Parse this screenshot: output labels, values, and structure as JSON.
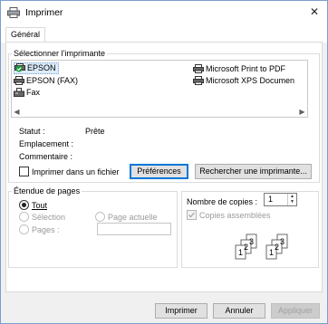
{
  "window": {
    "title": "Imprimer",
    "close_glyph": "✕"
  },
  "tabs": [
    {
      "label": "Général"
    }
  ],
  "printer_group": {
    "label": "Sélectionner l’imprimante",
    "printers": [
      {
        "name": "EPSON",
        "icon": "printer-default-icon",
        "selected": true
      },
      {
        "name": "Microsoft Print to PDF",
        "icon": "printer-icon"
      },
      {
        "name": "EPSON (FAX)",
        "icon": "printer-icon"
      },
      {
        "name": "Microsoft XPS Documen",
        "icon": "printer-icon"
      },
      {
        "name": "Fax",
        "icon": "fax-icon"
      }
    ],
    "status_label": "Statut :",
    "status_value": "Prête",
    "location_label": "Emplacement :",
    "comment_label": "Commentaire :",
    "print_to_file_label": "Imprimer dans un fichier",
    "preferences_button": "Préférences",
    "find_printer_button": "Rechercher une imprimante..."
  },
  "page_range": {
    "label": "Étendue de pages",
    "all": "Tout",
    "selection": "Sélection",
    "current_page": "Page actuelle",
    "pages": "Pages :"
  },
  "copies": {
    "label": "Nombre de copies :",
    "value": "1",
    "collate_label": "Copies assemblées"
  },
  "footer": {
    "print_button": "Imprimer",
    "cancel_button": "Annuler",
    "apply_button": "Appliquer"
  },
  "colors": {
    "accent": "#0078d7",
    "selection": "#dcecfc"
  }
}
